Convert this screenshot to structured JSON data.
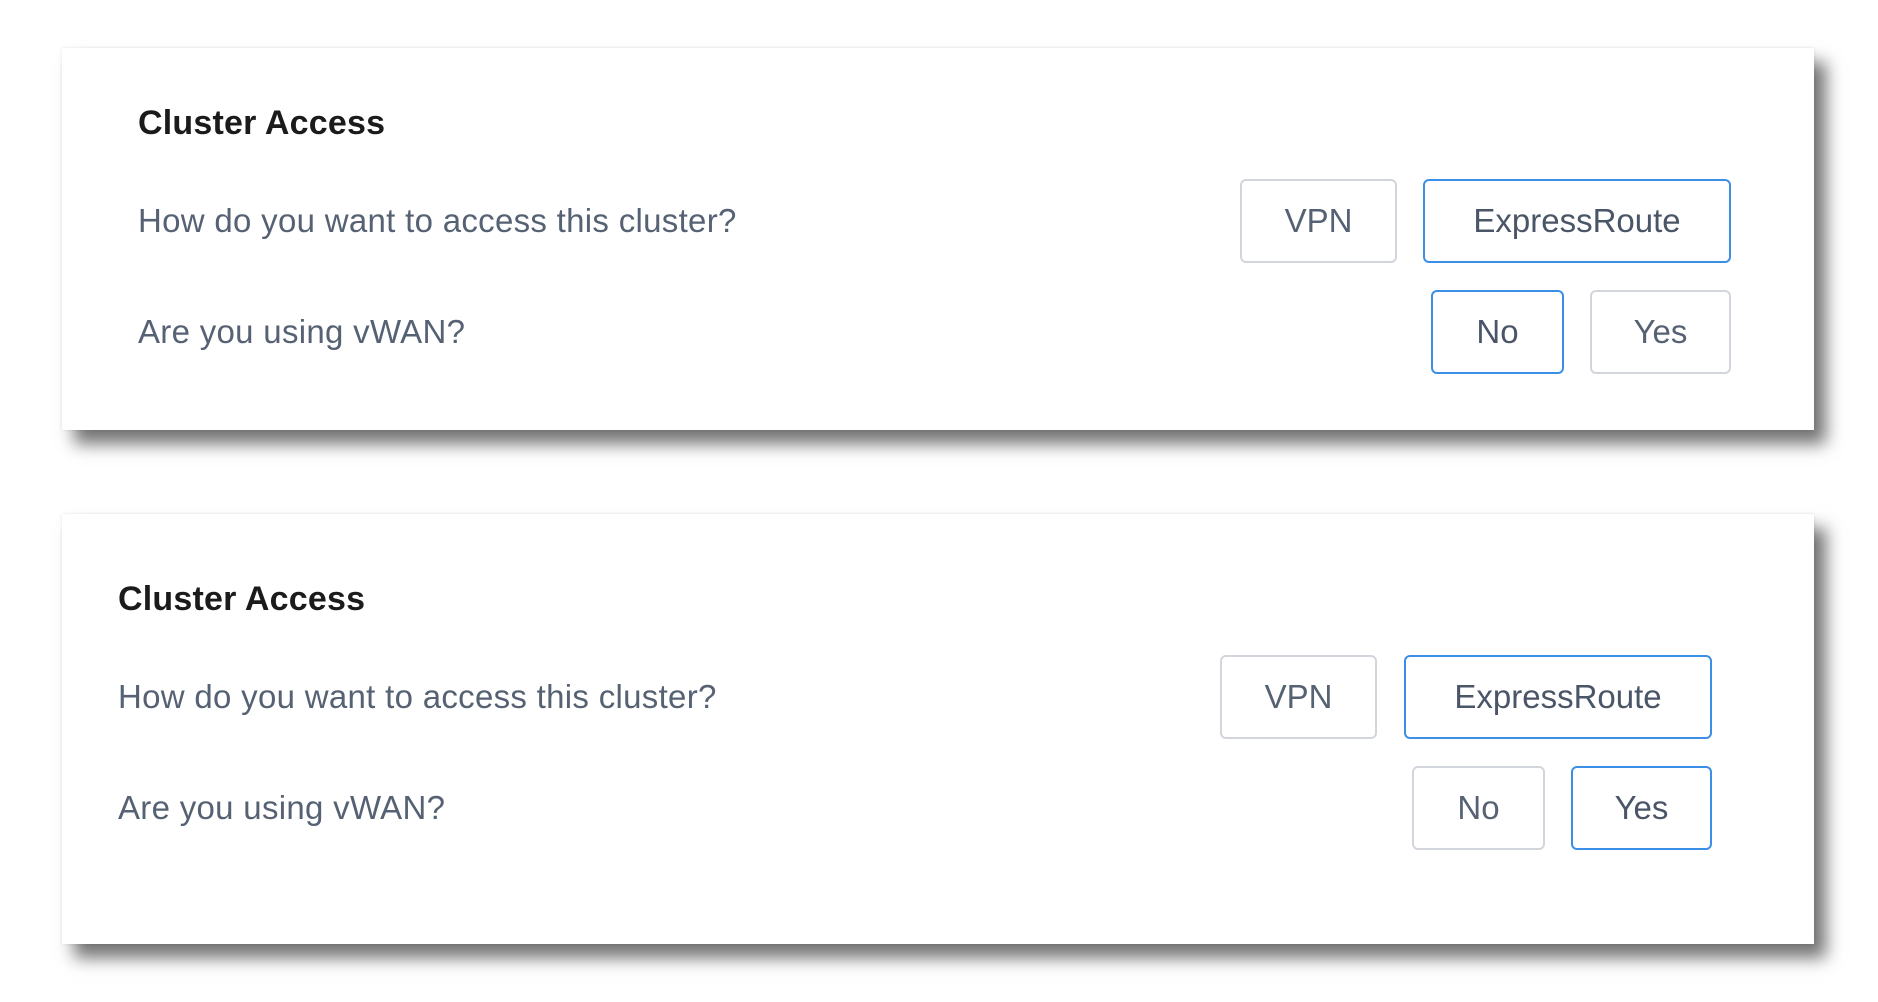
{
  "panels": [
    {
      "title": "Cluster Access",
      "access_question": "How do you want to access this cluster?",
      "access_options": [
        "VPN",
        "ExpressRoute"
      ],
      "access_selected": "ExpressRoute",
      "vwan_question": "Are you using vWAN?",
      "vwan_options": [
        "No",
        "Yes"
      ],
      "vwan_selected": "No"
    },
    {
      "title": "Cluster Access",
      "access_question": "How do you want to access this cluster?",
      "access_options": [
        "VPN",
        "ExpressRoute"
      ],
      "access_selected": "ExpressRoute",
      "vwan_question": "Are you using vWAN?",
      "vwan_options": [
        "No",
        "Yes"
      ],
      "vwan_selected": "Yes"
    }
  ],
  "colors": {
    "selected_border": "#3b8fe6",
    "default_border": "#d2d6dc",
    "question_text": "#566273",
    "title_text": "#1b1b1b"
  }
}
